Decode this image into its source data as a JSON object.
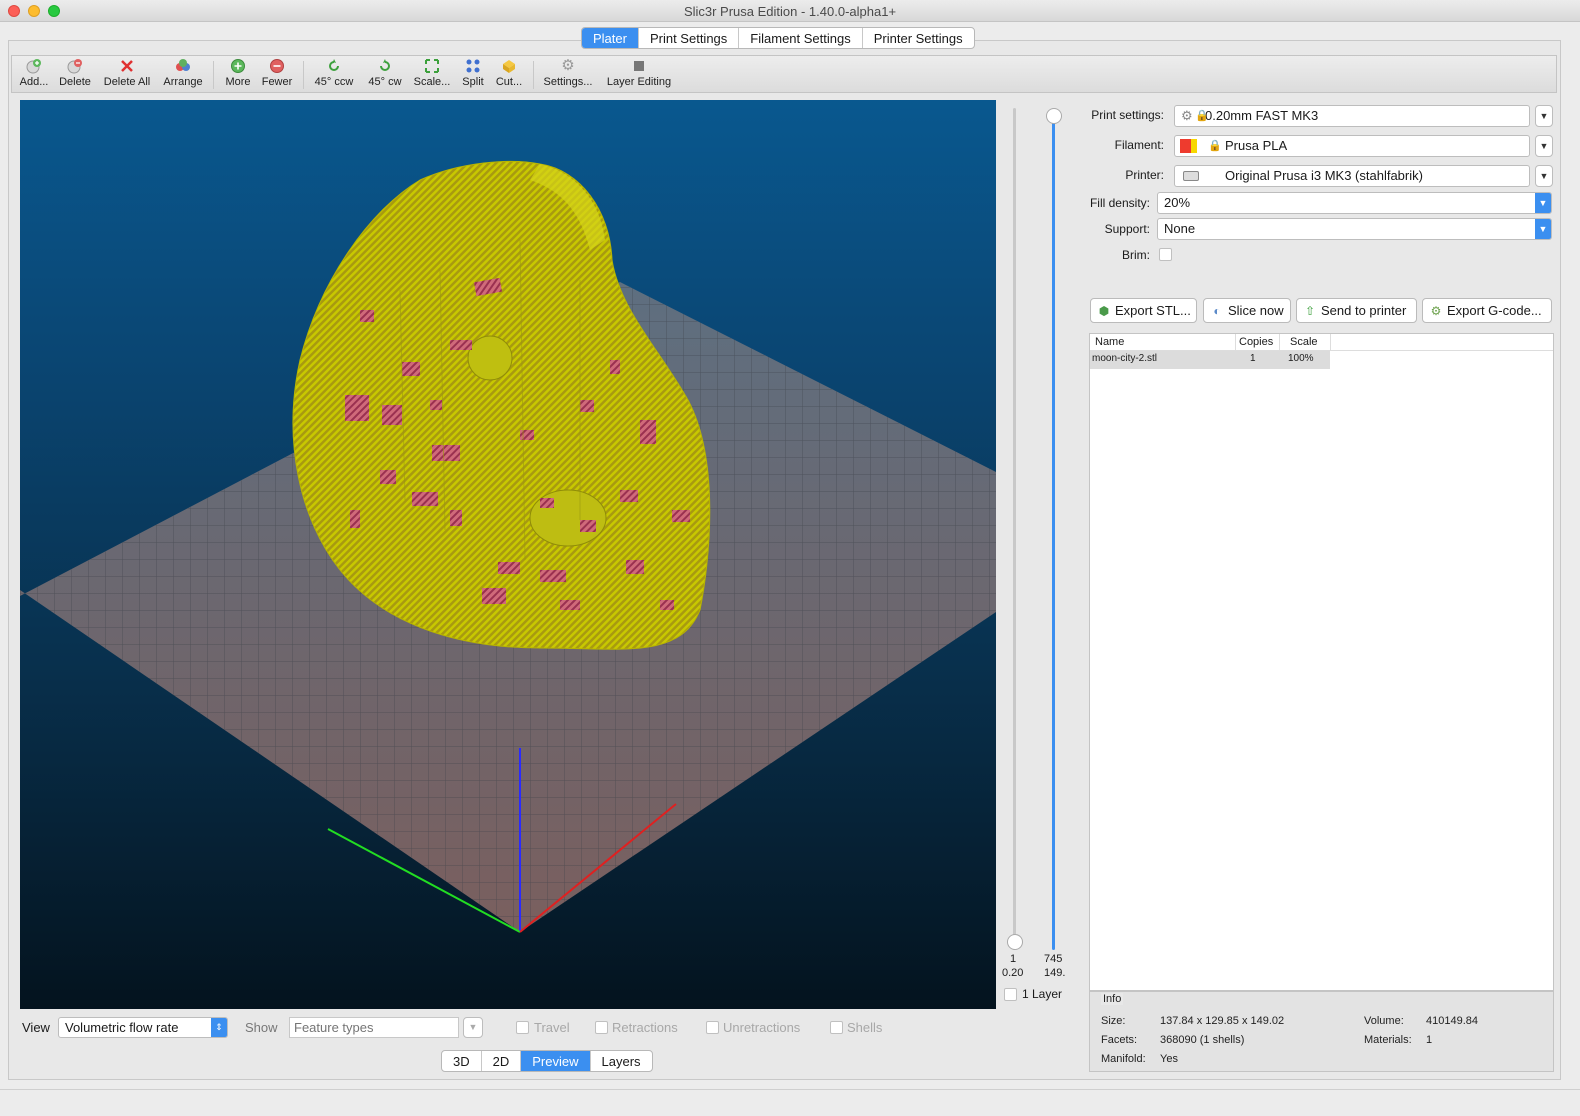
{
  "window": {
    "title": "Slic3r Prusa Edition - 1.40.0-alpha1+"
  },
  "tabs": [
    {
      "label": "Plater",
      "active": true
    },
    {
      "label": "Print Settings"
    },
    {
      "label": "Filament Settings"
    },
    {
      "label": "Printer Settings"
    }
  ],
  "toolbar": {
    "add": "Add...",
    "delete": "Delete",
    "delete_all": "Delete All",
    "arrange": "Arrange",
    "more": "More",
    "fewer": "Fewer",
    "rotate_ccw": "45° ccw",
    "rotate_cw": "45° cw",
    "scale": "Scale...",
    "split": "Split",
    "cut": "Cut...",
    "settings": "Settings...",
    "layer_editing": "Layer Editing"
  },
  "layer_slider": {
    "bottom_layer": "1",
    "bottom_height": "0.20",
    "top_layer": "745",
    "top_height": "149.",
    "one_layer_label": "1 Layer"
  },
  "presets": {
    "print_label": "Print settings:",
    "print_value": "0.20mm FAST MK3",
    "filament_label": "Filament:",
    "filament_value": "Prusa PLA",
    "printer_label": "Printer:",
    "printer_value": "Original Prusa i3 MK3 (stahlfabrik)",
    "fill_label": "Fill density:",
    "fill_value": "20%",
    "support_label": "Support:",
    "support_value": "None",
    "brim_label": "Brim:"
  },
  "actions": {
    "export_stl": "Export STL...",
    "slice_now": "Slice now",
    "send_to_printer": "Send to printer",
    "export_gcode": "Export G-code..."
  },
  "object_list": {
    "columns": [
      "Name",
      "Copies",
      "Scale"
    ],
    "rows": [
      [
        "moon-city-2.stl",
        "1",
        "100%"
      ]
    ]
  },
  "info": {
    "title": "Info",
    "size_label": "Size:",
    "size_value": "137.84 x 129.85 x 149.02",
    "volume_label": "Volume:",
    "volume_value": "410149.84",
    "facets_label": "Facets:",
    "facets_value": "368090 (1 shells)",
    "materials_label": "Materials:",
    "materials_value": "1",
    "manifold_label": "Manifold:",
    "manifold_value": "Yes"
  },
  "bottom": {
    "view_label": "View",
    "view_value": "Volumetric flow rate",
    "show_label": "Show",
    "show_placeholder": "Feature types",
    "travel": "Travel",
    "retractions": "Retractions",
    "unretractions": "Unretractions",
    "shells": "Shells"
  },
  "view_tabs": [
    {
      "label": "3D"
    },
    {
      "label": "2D"
    },
    {
      "label": "Preview",
      "active": true
    },
    {
      "label": "Layers"
    }
  ],
  "colors": {
    "accent": "#3b8ff0",
    "model": "#c8c800",
    "model_highlight": "#c85a6e",
    "axis_x": "#e02020",
    "axis_y": "#20d020",
    "axis_z": "#2020ff"
  }
}
